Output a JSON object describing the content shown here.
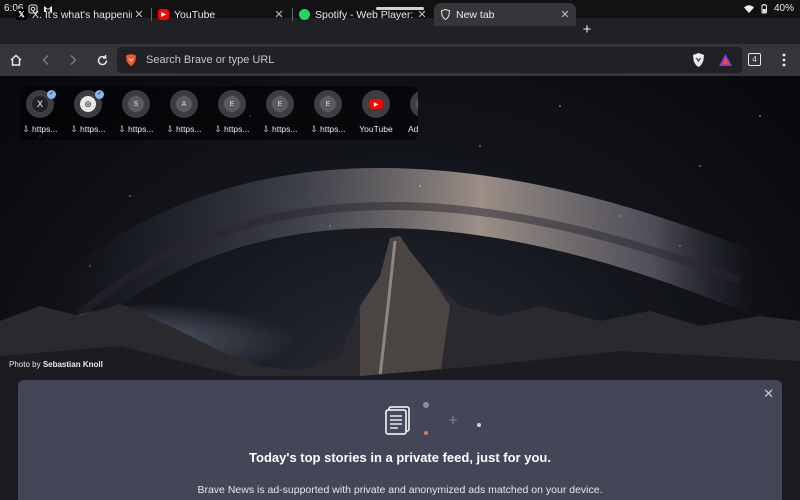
{
  "status_bar": {
    "time": "6:06",
    "battery": "40%",
    "icons": [
      "instagram-icon",
      "gmail-icon",
      "wifi-icon",
      "battery-icon"
    ]
  },
  "tabs": [
    {
      "title": "X. It's what's happening",
      "favicon": "x-icon",
      "active": false
    },
    {
      "title": "YouTube",
      "favicon": "youtube-icon",
      "active": false
    },
    {
      "title": "Spotify - Web Player: M",
      "favicon": "spotify-icon",
      "active": false
    },
    {
      "title": "New tab",
      "favicon": "brave-shield-icon",
      "active": true
    }
  ],
  "toolbar": {
    "url_placeholder": "Search Brave or type URL",
    "tab_count": "4"
  },
  "shortcuts": [
    {
      "letter": "X",
      "label": "⇩ https...",
      "verified": true
    },
    {
      "letter": "⊛",
      "label": "⇩ https...",
      "verified": true
    },
    {
      "letter": "S",
      "label": "⇩ https...",
      "verified": false
    },
    {
      "letter": "A",
      "label": "⇩ https...",
      "verified": false
    },
    {
      "letter": "E",
      "label": "⇩ https...",
      "verified": false
    },
    {
      "letter": "E",
      "label": "⇩ https...",
      "verified": false
    },
    {
      "letter": "E",
      "label": "⇩ https...",
      "verified": false
    },
    {
      "letter": "▶",
      "label": "YouTube",
      "verified": false
    },
    {
      "letter": "",
      "label": "Ad",
      "verified": false
    }
  ],
  "background": {
    "credit_prefix": "Photo by",
    "credit_name": "Sebastian Knoll"
  },
  "news": {
    "title": "Today's top stories in a private feed, just for you.",
    "subtitle": "Brave News is ad-supported with private and anonymized ads matched on your device."
  },
  "colors": {
    "brave_orange": "#fb542b",
    "youtube_red": "#ff0000",
    "spotify_green": "#1ed760",
    "card_bg": "#484a5c"
  }
}
